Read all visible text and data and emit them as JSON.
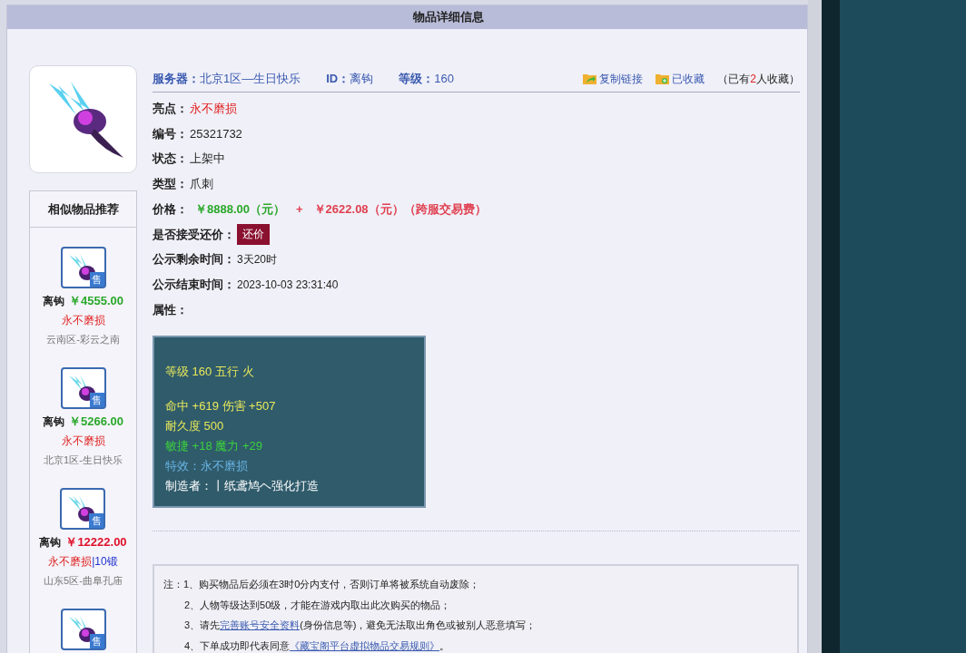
{
  "header": {
    "title": "物品详细信息"
  },
  "summary": {
    "server_label": "服务器：",
    "server": "北京1区—生日快乐",
    "id_label": "ID：",
    "id": "离钩",
    "level_label": "等级：",
    "level": "160"
  },
  "actions": [
    {
      "label": "复制链接",
      "kind": "share"
    },
    {
      "label": "已收藏",
      "kind": "add"
    }
  ],
  "favorites": {
    "before": "（已有",
    "count": "2",
    "after": "人收藏）"
  },
  "fields": [
    {
      "label": "亮点：",
      "value": "永不磨损",
      "highlight": true
    },
    {
      "label": "编号：",
      "value": "25321732",
      "highlight": false
    },
    {
      "label": "状态：",
      "value": "上架中",
      "highlight": false
    },
    {
      "label": "类型：",
      "value": "爪刺",
      "highlight": false
    }
  ],
  "price": {
    "label": "价格：",
    "main": "￥8888.00（元）",
    "plus": "+",
    "fee": "￥2622.08（元）（跨服交易费）"
  },
  "bargain": {
    "label": "是否接受还价：",
    "button": "还价"
  },
  "times": [
    {
      "label": "公示剩余时间：",
      "value": "3天20时"
    },
    {
      "label": "公示结束时间：",
      "value": "2023-10-03 23:31:40"
    }
  ],
  "attributes_label": "属性：",
  "attributes": [
    [
      {
        "text": "等级 160 五行 火",
        "color": "#e8e85a"
      }
    ],
    [
      {
        "text": "命中 +619 伤害 +507",
        "color": "#e8e85a"
      },
      {
        "text": "耐久度 500",
        "color": "#e8e85a"
      },
      {
        "text": "敏捷 +18 魔力 +29",
        "color": "#3cd23c"
      },
      {
        "text": "特效：永不磨损",
        "color": "#6ab4e4"
      },
      {
        "text": "制造者：丨纸鸢鸠ヘ强化打造",
        "color": "#ffffff"
      }
    ]
  ],
  "similar": {
    "title": "相似物品推荐",
    "items": [
      {
        "badge": "售",
        "name": "离钩",
        "price": "￥4555.00",
        "color": "#2aa82a",
        "tag": "永不磨损",
        "server": "云南区-彩云之南"
      },
      {
        "badge": "售",
        "name": "离钩",
        "price": "￥5266.00",
        "color": "#2aa82a",
        "tag": "永不磨损",
        "server": "北京1区-生日快乐"
      },
      {
        "badge": "售",
        "name": "离钩",
        "price": "￥12222.00",
        "color": "#e0102a",
        "tag": "永不磨损",
        "extra": "|10锻",
        "server": "山东5区-曲阜孔庙"
      },
      {
        "badge": "售"
      }
    ]
  },
  "notes": [
    [
      {
        "text": "注：1、购买物品后必须在3时0分内支付，否则订单将被系统自动废除；"
      }
    ],
    [
      {
        "text": "2、人物等级达到50级，才能在游戏内取出此次购买的物品；"
      }
    ],
    [
      {
        "text": "3、请先"
      },
      {
        "text": "完善账号安全资料",
        "link": true
      },
      {
        "text": "(身份信息等)，避免无法取出角色或被别人恶意填写；"
      }
    ],
    [
      {
        "text": "4、下单成功即代表同意"
      },
      {
        "text": "《藏宝阁平台虚拟物品交易规则》",
        "link": true
      },
      {
        "text": "。"
      }
    ]
  ]
}
